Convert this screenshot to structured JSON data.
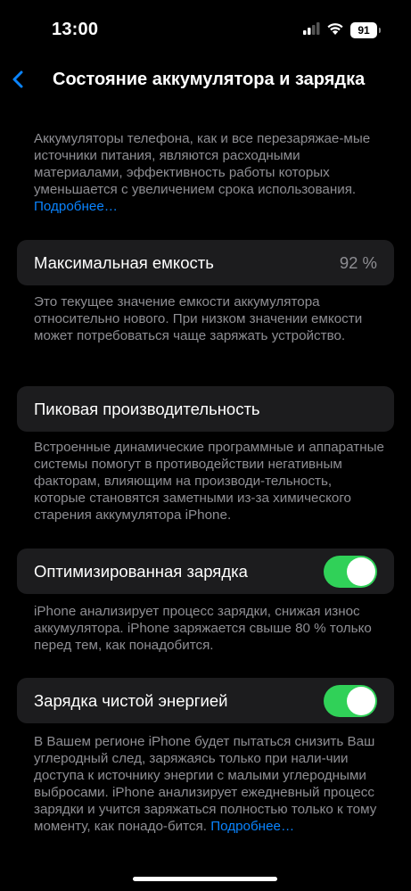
{
  "status_bar": {
    "time": "13:00",
    "battery_level": "91",
    "icons": [
      "cellular-signal-icon",
      "wifi-icon",
      "battery-icon"
    ]
  },
  "nav": {
    "title": "Состояние аккумулятора и зарядка",
    "back_icon": "chevron-left-icon"
  },
  "intro": {
    "text": "Аккумуляторы телефона, как и все перезаряжае-мые источники питания, являются расходными материалами, эффективность работы которых уменьшается с увеличением срока использования.",
    "link": "Подробнее…"
  },
  "max_capacity": {
    "label": "Максимальная емкость",
    "value": "92 %",
    "description": "Это текущее значение емкости аккумулятора относительно нового. При низком значении емкости может потребоваться чаще заряжать устройство."
  },
  "peak_performance": {
    "label": "Пиковая производительность",
    "description": "Встроенные динамические программные и аппаратные системы помогут в противодействии негативным факторам, влияющим на производи-тельность, которые становятся заметными из-за химического старения аккумулятора iPhone."
  },
  "optimized_charging": {
    "label": "Оптимизированная зарядка",
    "enabled": true,
    "description": "iPhone анализирует процесс зарядки, снижая износ аккумулятора. iPhone заряжается свыше 80 % только перед тем, как понадобится."
  },
  "clean_energy": {
    "label": "Зарядка чистой энергией",
    "enabled": true,
    "description": "В Вашем регионе iPhone будет пытаться снизить Ваш углеродный след, заряжаясь только при нали-чии доступа к источнику энергии с малыми углеродными выбросами. iPhone анализирует ежедневный процесс зарядки и учится заряжаться полностью только к тому моменту, как понадо-бится.",
    "link": "Подробнее…"
  },
  "colors": {
    "background": "#000000",
    "cell": "#1c1c1e",
    "secondary_text": "#8e8e93",
    "link": "#0a84ff",
    "toggle_on": "#30d158"
  }
}
